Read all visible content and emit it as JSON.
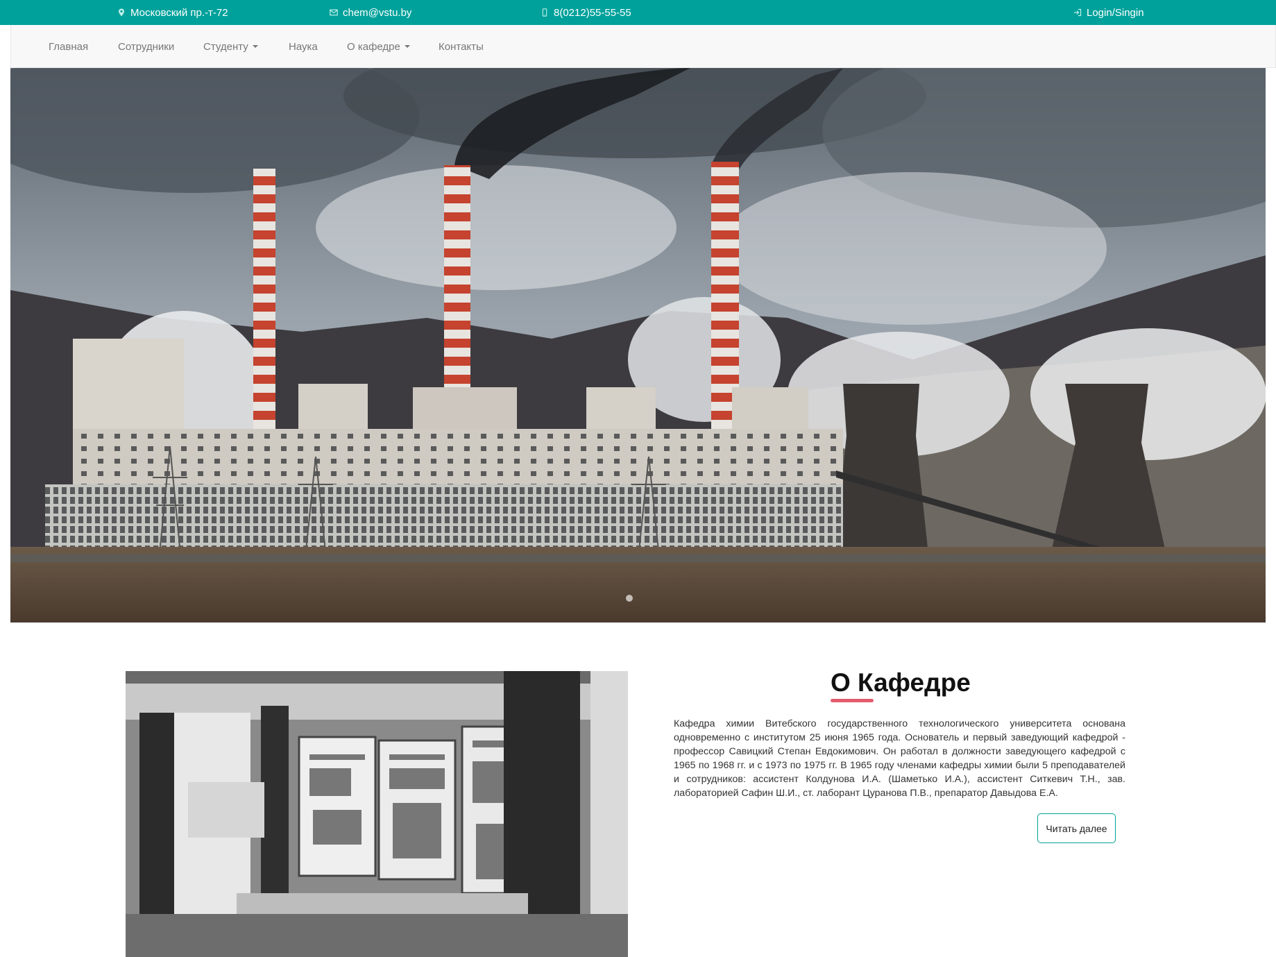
{
  "topbar": {
    "address": "Московский пр.-т-72",
    "address_icon": "map-marker-icon",
    "email": "chem@vstu.by",
    "email_icon": "envelope-icon",
    "phone": "8(0212)55-55-55",
    "phone_icon": "mobile-phone-icon",
    "login": "Login/Singin",
    "login_icon": "sign-in-icon",
    "bg_color": "#00a19b"
  },
  "nav": {
    "items": [
      {
        "label": "Главная"
      },
      {
        "label": "Сотрудники"
      },
      {
        "label": "Студенту",
        "dropdown": true
      },
      {
        "label": "Наука"
      },
      {
        "label": "О кафедре",
        "dropdown": true
      },
      {
        "label": "Контакты"
      }
    ]
  },
  "about": {
    "title": "О Кафедре",
    "text": "Кафедра химии Витебского государственного технологического университета основана одновременно с институтом 25 июня 1965 года. Основатель и первый заведующий кафедрой - профессор Савицкий Степан Евдокимович. Он работал в должности заведующего кафедрой с 1965 по 1968 гг. и с 1973 по 1975 гг. В 1965 году членами кафедры химии были 5 преподавателей и сотрудников: ассистент Колдунова И.А. (Шаметько И.А.), ассистент Ситкевич Т.Н., зав. лабораторией Сафин Ш.И., ст. лаборант Цуранова П.В., препаратор Давыдова Е.А.",
    "read_more": "Читать далее",
    "accent_color": "#e25c6e"
  }
}
